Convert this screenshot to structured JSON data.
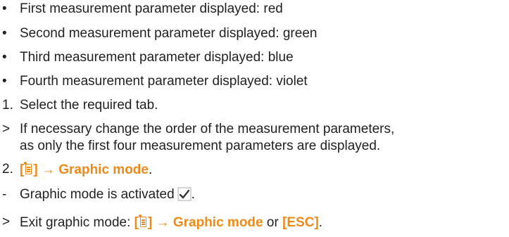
{
  "bullets": [
    {
      "marker": "•",
      "text": "First measurement parameter displayed: red"
    },
    {
      "marker": "•",
      "text": "Second measurement parameter displayed: green"
    },
    {
      "marker": "•",
      "text": "Third measurement parameter displayed: blue"
    },
    {
      "marker": "•",
      "text": "Fourth measurement parameter displayed: violet"
    }
  ],
  "step1": {
    "marker": "1.",
    "text": "Select the required tab."
  },
  "result1": {
    "marker": ">",
    "line1": "If necessary change the order of the measurement parameters,",
    "line2": "as only the first four measurement parameters are displayed."
  },
  "step2": {
    "marker": "2.",
    "bracket_open": "[",
    "bracket_close": "]",
    "arrow": " → ",
    "menu_item": "Graphic mode",
    "period": "."
  },
  "step2_result": {
    "marker": "-",
    "text": "Graphic mode is activated",
    "period": "."
  },
  "exit": {
    "marker": ">",
    "prefix": "Exit graphic mode: ",
    "bracket_open": "[",
    "bracket_close": "]",
    "arrow": " → ",
    "menu_item": "Graphic mode",
    "or_text": " or ",
    "esc_key": "[ESC]",
    "period": "."
  },
  "colors": {
    "text": "#222222",
    "accent": "#ee8a1a",
    "checkbox_border": "#bbbbbb",
    "checkmark": "#333333"
  },
  "icons": {
    "menu": "menu-icon",
    "check": "checkbox-checked-icon"
  }
}
